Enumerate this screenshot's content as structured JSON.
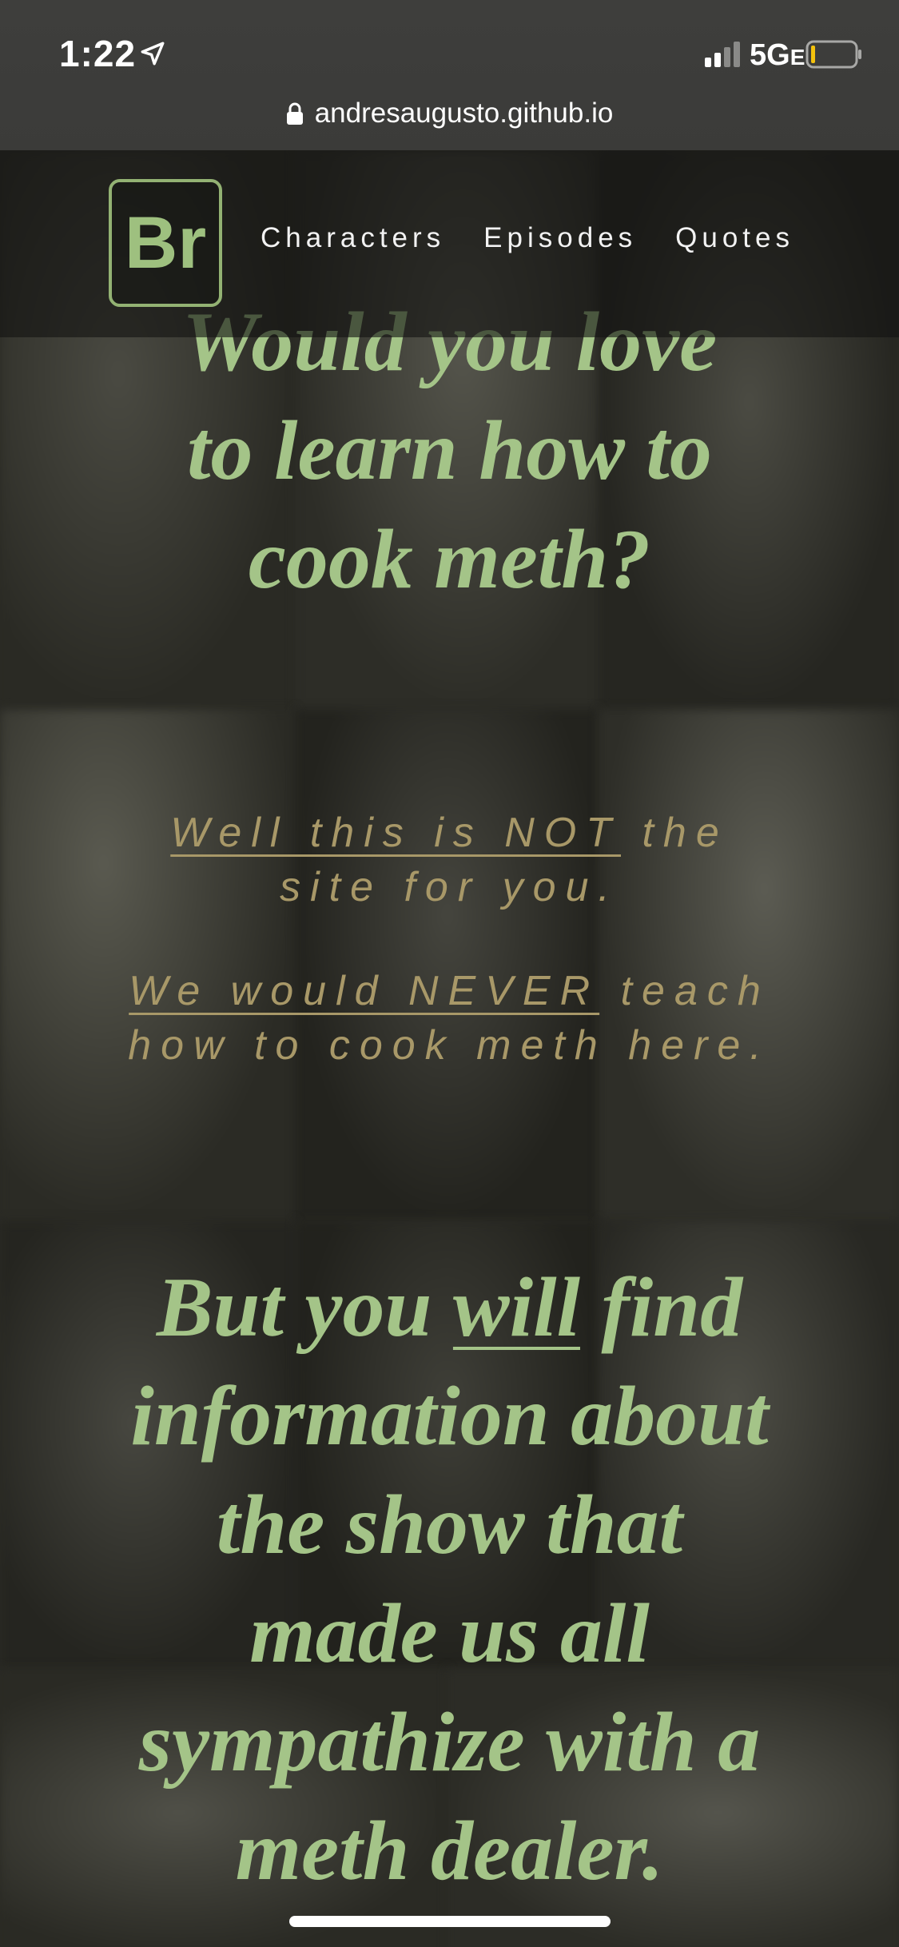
{
  "status_bar": {
    "time": "1:22",
    "network": "5G",
    "network_suffix": "E",
    "location_icon": "location-arrow-icon",
    "signal_icon": "signal-bars-icon",
    "battery_icon": "battery-low-icon",
    "battery_level": 0.08
  },
  "browser": {
    "url": "andresaugusto.github.io",
    "lock_icon": "lock-icon"
  },
  "site_nav": {
    "logo_text": "Br",
    "links": [
      {
        "label": "Characters"
      },
      {
        "label": "Episodes"
      },
      {
        "label": "Quotes"
      }
    ]
  },
  "content": {
    "hero_heading": "Would you love to learn how to cook meth?",
    "tagline_1_underlined": "Well this is NOT",
    "tagline_1_rest": " the site for you.",
    "tagline_2_underlined": "We would NEVER",
    "tagline_2_rest": " teach how to cook meth here.",
    "closing_prefix": "But you ",
    "closing_underlined": "will",
    "closing_rest": " find information about the show that made us all sympathize with a meth dealer."
  },
  "colors": {
    "accent_green": "#a4c488",
    "tagline_gold": "#a89868",
    "logo_border": "#93b273"
  }
}
